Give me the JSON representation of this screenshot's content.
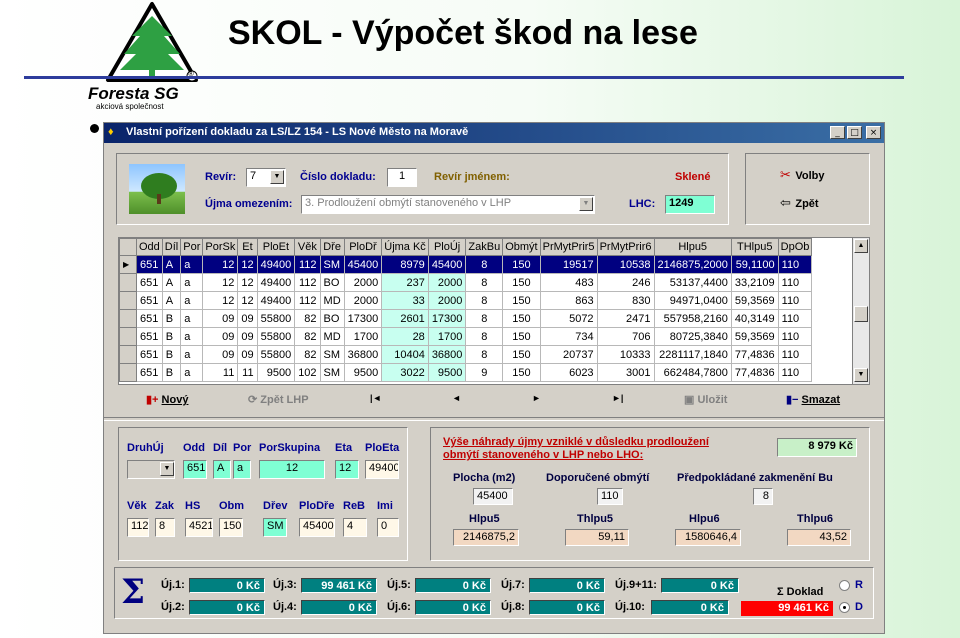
{
  "slide": {
    "title": "SKOL - Výpočet škod na lese"
  },
  "logo": {
    "brand": "Foresta SG",
    "tagline": "akciová společnost",
    "mark": "®"
  },
  "window": {
    "title": "Vlastní pořízení dokladu za LS/LZ 154 - LS Nové Město na Moravě",
    "minimize": "_",
    "maximize": "□",
    "close": "×"
  },
  "header": {
    "revir_label": "Revír:",
    "revir_value": "7",
    "cislo_label": "Číslo dokladu:",
    "cislo_value": "1",
    "revir_jmenem_label": "Revír jménem:",
    "revir_jmenem_value": "Sklené",
    "ujma_label": "Újma omezením:",
    "ujma_value": "3. Prodloužení obmýtí stanoveného v LHP",
    "lhc_label": "LHC:",
    "lhc_value": "1249",
    "volby_label": "Volby",
    "zpet_label": "Zpět"
  },
  "grid": {
    "columns": [
      "Odd",
      "Díl",
      "Por",
      "PorSk",
      "Et",
      "PloEt",
      "Věk",
      "Dře",
      "PloDř",
      "Újma Kč",
      "PloÚj",
      "ZakBu",
      "Obmýt",
      "PrMytPrir5",
      "PrMytPrir6",
      "Hlpu5",
      "THlpu5",
      "DpOb"
    ],
    "rows": [
      [
        "651",
        "A",
        "a",
        "12",
        "12",
        "49400",
        "112",
        "SM",
        "45400",
        "8979",
        "45400",
        "8",
        "150",
        "19517",
        "10538",
        "2146875,2000",
        "59,1100",
        "110"
      ],
      [
        "651",
        "A",
        "a",
        "12",
        "12",
        "49400",
        "112",
        "BO",
        "2000",
        "237",
        "2000",
        "8",
        "150",
        "483",
        "246",
        "53137,4400",
        "33,2109",
        "110"
      ],
      [
        "651",
        "A",
        "a",
        "12",
        "12",
        "49400",
        "112",
        "MD",
        "2000",
        "33",
        "2000",
        "8",
        "150",
        "863",
        "830",
        "94971,0400",
        "59,3569",
        "110"
      ],
      [
        "651",
        "B",
        "a",
        "09",
        "09",
        "55800",
        "82",
        "BO",
        "17300",
        "2601",
        "17300",
        "8",
        "150",
        "5072",
        "2471",
        "557958,2160",
        "40,3149",
        "110"
      ],
      [
        "651",
        "B",
        "a",
        "09",
        "09",
        "55800",
        "82",
        "MD",
        "1700",
        "28",
        "1700",
        "8",
        "150",
        "734",
        "706",
        "80725,3840",
        "59,3569",
        "110"
      ],
      [
        "651",
        "B",
        "a",
        "09",
        "09",
        "55800",
        "82",
        "SM",
        "36800",
        "10404",
        "36800",
        "8",
        "150",
        "20737",
        "10333",
        "2281117,1840",
        "77,4836",
        "110"
      ],
      [
        "651",
        "B",
        "a",
        "11",
        "11",
        "9500",
        "102",
        "SM",
        "9500",
        "3022",
        "9500",
        "9",
        "150",
        "6023",
        "3001",
        "662484,7800",
        "77,4836",
        "110"
      ]
    ]
  },
  "nav": {
    "novy": "Nový",
    "zpet_lhp": "Zpět LHP",
    "first": "|◄",
    "prev": "◄",
    "next": "►",
    "last": "►|",
    "ulozit": "Uložit",
    "smazat": "Smazat"
  },
  "detail": {
    "labels1": [
      "DruhÚj",
      "Odd",
      "Díl",
      "Por",
      "PorSkupina",
      "Eta",
      "PloEta"
    ],
    "values1": [
      "",
      "651",
      "A",
      "a",
      "12",
      "12",
      "49400"
    ],
    "labels2": [
      "Věk",
      "Zak",
      "HS",
      "Obm",
      "Dřev",
      "PloDře",
      "ReB",
      "Imi"
    ],
    "values2": [
      "112",
      "8",
      "4521",
      "150",
      "SM",
      "45400",
      "4",
      "0"
    ]
  },
  "result": {
    "heading1": "Výše náhrady újmy vzniklé v důsledku prodloužení",
    "heading2": "obmýtí stanoveného v LHP nebo LHO:",
    "total": "8 979 Kč",
    "plocha_label": "Plocha (m2)",
    "plocha_value": "45400",
    "obmyti_label": "Doporučené obmýtí",
    "obmyti_value": "110",
    "zakm_label": "Předpokládané zakmenění Bu",
    "zakm_value": "8",
    "hlpu5_label": "Hlpu5",
    "hlpu5_value": "2146875,2",
    "thlpu5_label": "Thlpu5",
    "thlpu5_value": "59,11",
    "hlpu6_label": "Hlpu6",
    "hlpu6_value": "1580646,4",
    "thlpu6_label": "Thlpu6",
    "thlpu6_value": "43,52"
  },
  "summary": {
    "sigma": "Σ",
    "items": [
      {
        "label": "Új.1:",
        "value": "0 Kč"
      },
      {
        "label": "Új.2:",
        "value": "0 Kč"
      },
      {
        "label": "Új.3:",
        "value": "99 461 Kč"
      },
      {
        "label": "Új.4:",
        "value": "0 Kč"
      },
      {
        "label": "Új.5:",
        "value": "0 Kč"
      },
      {
        "label": "Új.6:",
        "value": "0 Kč"
      },
      {
        "label": "Új.7:",
        "value": "0 Kč"
      },
      {
        "label": "Új.8:",
        "value": "0 Kč"
      },
      {
        "label": "Új.9+11:",
        "value": "0 Kč"
      },
      {
        "label": "Új.10:",
        "value": "0 Kč"
      }
    ],
    "doklad_label": "Σ Doklad",
    "doklad_value": "99 461 Kč",
    "radio_r": "R",
    "radio_d": "D"
  },
  "colors": {
    "titlebar": "#0a246a",
    "selected_row": "#000080",
    "teal": "#008080",
    "red": "#ff0000"
  }
}
